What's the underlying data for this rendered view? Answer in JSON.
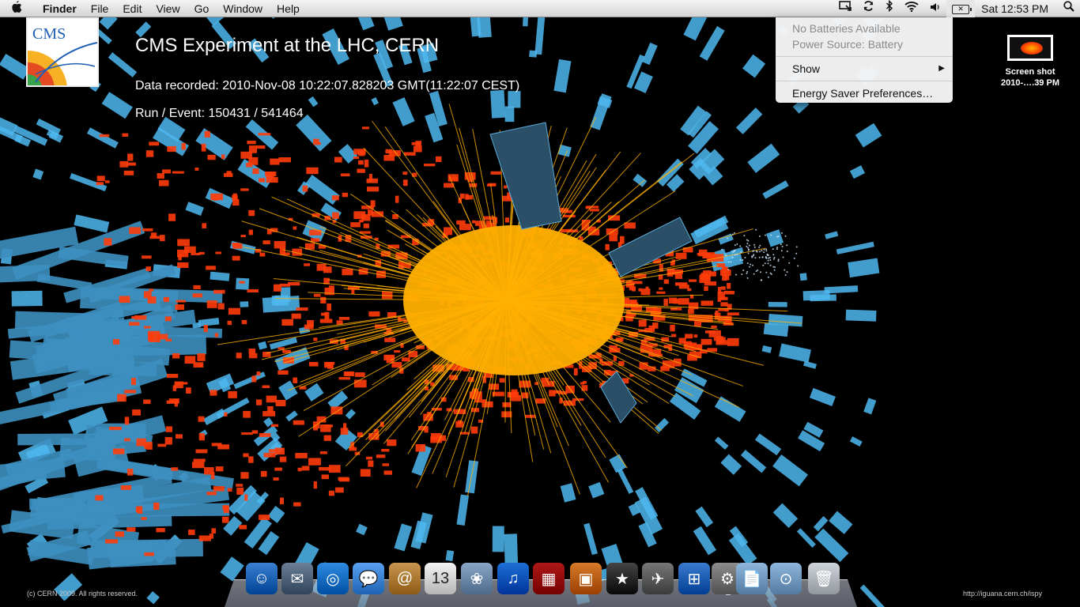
{
  "menubar": {
    "app_name": "Finder",
    "menus": [
      "File",
      "Edit",
      "View",
      "Go",
      "Window",
      "Help"
    ],
    "clock": "Sat 12:53 PM"
  },
  "battery_menu": {
    "status_line_1": "No Batteries Available",
    "status_line_2": "Power Source: Battery",
    "show_label": "Show",
    "prefs_label": "Energy Saver Preferences…"
  },
  "wallpaper": {
    "logo_text": "CMS",
    "title": "CMS Experiment at the LHC, CERN",
    "data_recorded": "Data recorded: 2010-Nov-08 10:22:07.828203 GMT(11:22:07 CEST)",
    "run_event": "Run / Event: 150431 / 541464",
    "copyright": "(c) CERN 2009. All rights reserved.",
    "url": "http://iguana.cern.ch/ispy",
    "colors": {
      "calo_blue": "#4fb8f0",
      "hcal_red": "#ff3c0a",
      "track_yellow": "#ffb000"
    }
  },
  "desktop_icon": {
    "line1": "Screen shot",
    "line2": "2010-….39 PM"
  },
  "dock": {
    "items": [
      {
        "name": "finder-icon",
        "color": "#3a7fd0",
        "glyph": "☺"
      },
      {
        "name": "mail-icon",
        "color": "#6b7f96",
        "glyph": "✉"
      },
      {
        "name": "safari-icon",
        "color": "#2e8be0",
        "glyph": "◎"
      },
      {
        "name": "ichat-icon",
        "color": "#5aa0f0",
        "glyph": "💬"
      },
      {
        "name": "address-book-icon",
        "color": "#c9964f",
        "glyph": "@"
      },
      {
        "name": "ical-icon",
        "color": "#f2f2f2",
        "glyph": "13"
      },
      {
        "name": "iphoto-icon",
        "color": "#8aa6c6",
        "glyph": "❀"
      },
      {
        "name": "itunes-icon",
        "color": "#1d6fd6",
        "glyph": "♫"
      },
      {
        "name": "photo-booth-icon",
        "color": "#b01818",
        "glyph": "▦"
      },
      {
        "name": "photos-icon",
        "color": "#d67b2a",
        "glyph": "▣"
      },
      {
        "name": "imovie-icon",
        "color": "#444444",
        "glyph": "★"
      },
      {
        "name": "time-machine-icon",
        "color": "#777777",
        "glyph": "✈"
      },
      {
        "name": "boot-camp-icon",
        "color": "#3b7bcf",
        "glyph": "⊞"
      },
      {
        "name": "system-preferences-icon",
        "color": "#8c8c8c",
        "glyph": "⚙"
      },
      {
        "name": "documents-folder-icon",
        "color": "#8fb6dc",
        "glyph": "📄"
      },
      {
        "name": "downloads-folder-icon",
        "color": "#8fb6dc",
        "glyph": "⊙"
      },
      {
        "name": "trash-icon",
        "color": "#cfd4da",
        "glyph": "🗑"
      }
    ]
  }
}
